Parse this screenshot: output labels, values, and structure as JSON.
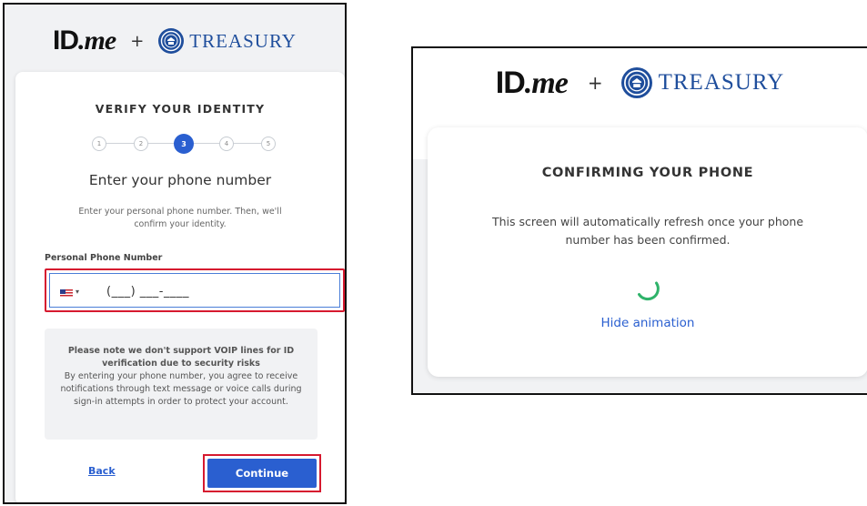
{
  "brand": {
    "id_text": "ID",
    "me_text": ".me",
    "plus": "+",
    "treasury": "TREASURY"
  },
  "left": {
    "title": "VERIFY YOUR IDENTITY",
    "steps": [
      "1",
      "2",
      "3",
      "4",
      "5"
    ],
    "current_step": 3,
    "heading": "Enter your phone number",
    "description": "Enter your personal phone number. Then, we'll confirm your identity.",
    "field_label": "Personal Phone Number",
    "phone_mask": "(___) ___-____",
    "notice_bold": "Please note we don't support VOIP lines for ID verification due to security risks",
    "notice_text": "By entering your phone number, you agree to receive notifications through text message or voice calls during sign-in attempts in order to protect your account.",
    "back_label": "Back",
    "continue_label": "Continue"
  },
  "right": {
    "title": "CONFIRMING YOUR PHONE",
    "description": "This screen will automatically refresh once your phone number has been confirmed.",
    "hide_animation": "Hide animation"
  },
  "colors": {
    "accent": "#2a5fd0",
    "highlight": "#d6192f",
    "spinner": "#2fb36a",
    "treasury": "#1f4e9c"
  }
}
